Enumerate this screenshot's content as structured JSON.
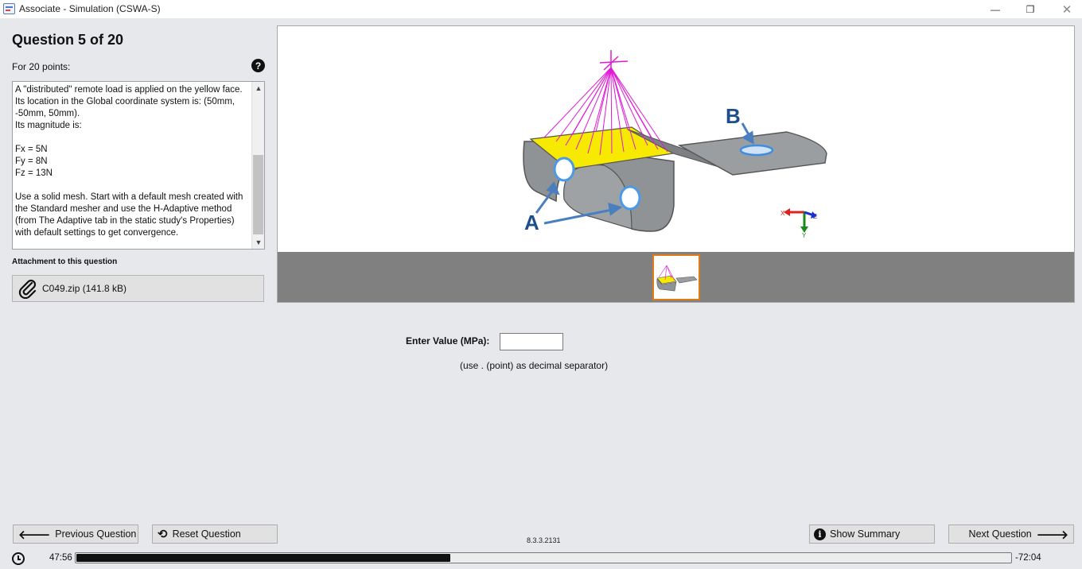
{
  "window": {
    "title": "Associate - Simulation (CSWA-S)",
    "minimize": "—",
    "maximize": "❐",
    "close": "✕"
  },
  "question": {
    "title": "Question 5 of 20",
    "points": "For 20 points:",
    "help": "?",
    "text": "A \"distributed\" remote load is applied on the yellow face. Its location in the Global coordinate system is: (50mm, -50mm, 50mm).\nIts magnitude is:\n\nFx = 5N\nFy = 8N\nFz = 13N\n\nUse a solid mesh. Start with a default mesh created with the Standard mesher and use the H-Adaptive method (from The Adaptive tab in the static study's Properties) with default settings to get convergence."
  },
  "attachment": {
    "label": "Attachment to this question",
    "file": "C049.zip (141.8 kB)"
  },
  "viewer": {
    "label_a": "A",
    "label_b": "B",
    "axis_x": "X",
    "axis_y": "Y",
    "axis_z": "Z",
    "icons": [
      "zoom-out-icon",
      "fit-icon",
      "zoom-in-icon"
    ]
  },
  "answer": {
    "label": "Enter Value (MPa):",
    "value": "",
    "hint": "(use . (point) as decimal separator)"
  },
  "nav": {
    "previous": "Previous Question",
    "reset": "Reset Question",
    "summary": "Show Summary",
    "next": "Next Question",
    "version": "8.3.3.2131"
  },
  "timer": {
    "elapsed": "47:56",
    "remaining": "-72:04",
    "progress_fraction": 0.4
  }
}
